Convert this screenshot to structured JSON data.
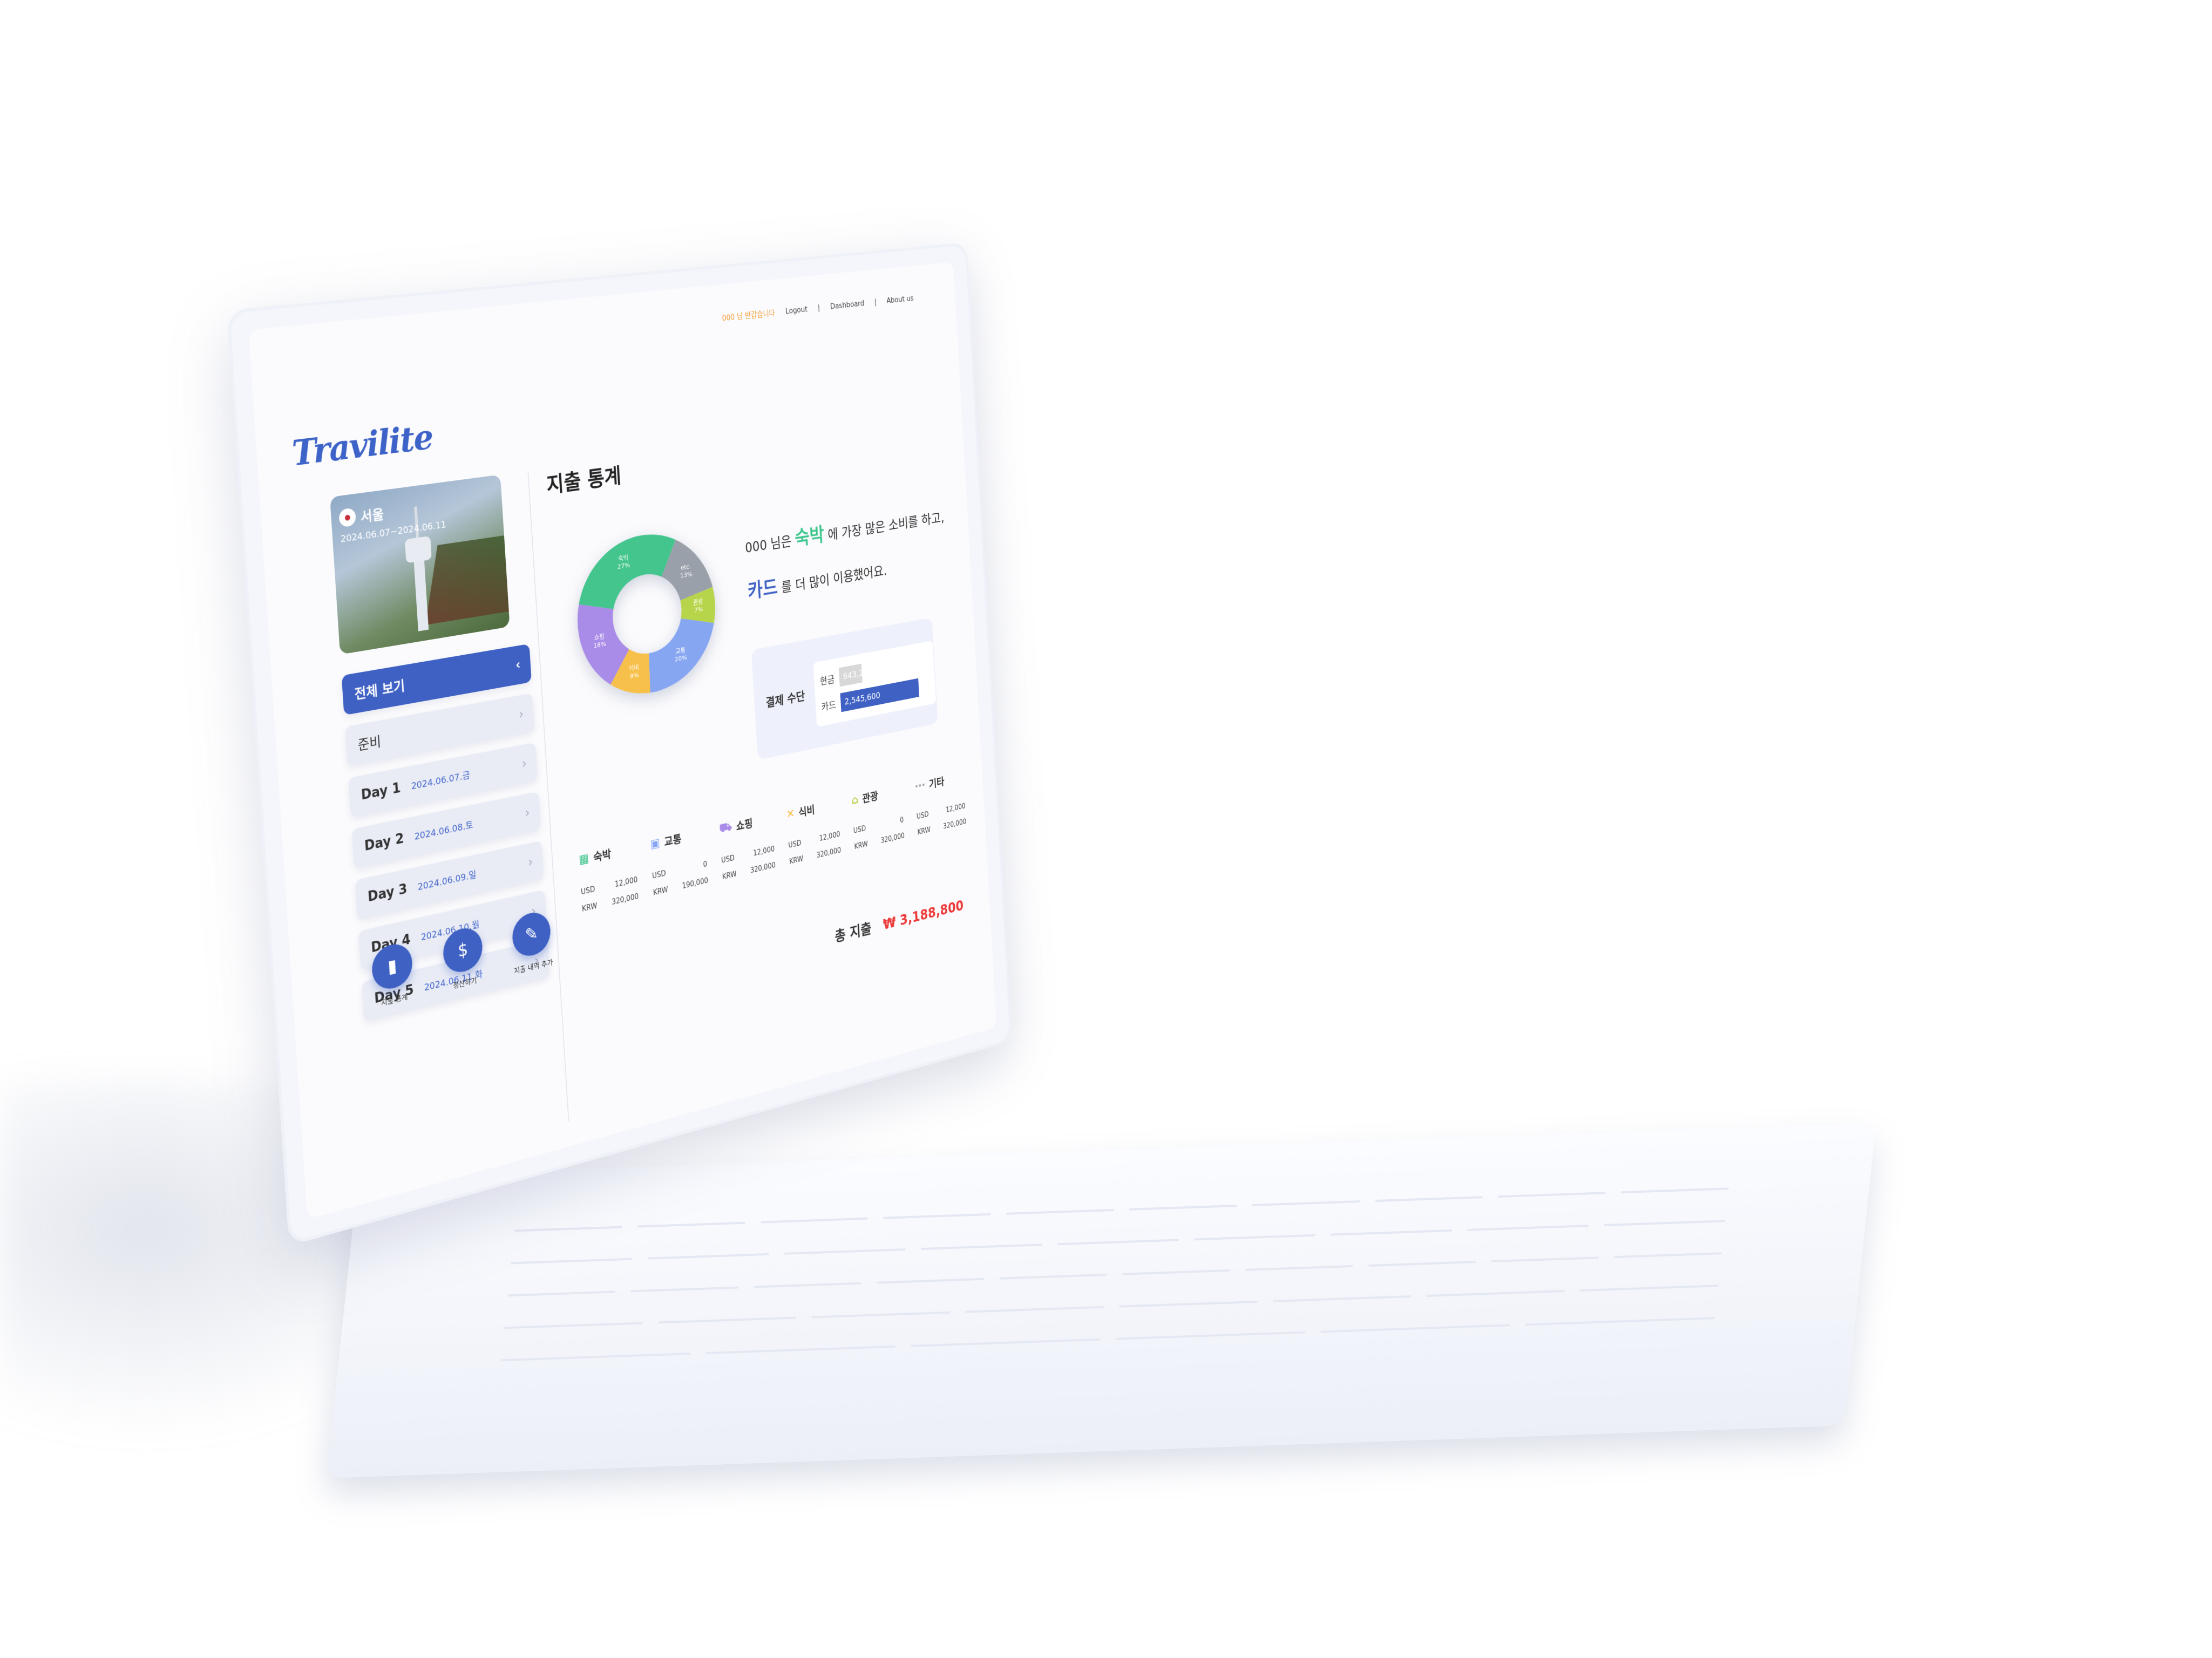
{
  "nav": {
    "user_greeting": "000 님 반갑습니다",
    "logout": "Logout",
    "sep": "|",
    "dashboard": "Dashboard",
    "about": "About us"
  },
  "logo": "Travilite",
  "trip": {
    "city": "서울",
    "dates": "2024.06.07~2024.06.11",
    "flag": "korea-flag-icon"
  },
  "menu": {
    "all": "전체 보기",
    "prep": "준비",
    "days": [
      {
        "label": "Day 1",
        "date": "2024.06.07.금"
      },
      {
        "label": "Day 2",
        "date": "2024.06.08.토"
      },
      {
        "label": "Day 3",
        "date": "2024.06.09.일"
      },
      {
        "label": "Day 4",
        "date": "2024.06.10.월"
      },
      {
        "label": "Day 5",
        "date": "2024.06.11.화"
      }
    ]
  },
  "fabs": [
    {
      "label": "지출 통계",
      "icon": "bar-chart-icon"
    },
    {
      "label": "정산하기",
      "icon": "receipt-icon"
    },
    {
      "label": "지출 내역 추가",
      "icon": "pencil-icon"
    }
  ],
  "main": {
    "title": "지출 통계",
    "summary_prefix": "000 님은",
    "summary_top_category": "숙박",
    "summary_mid": "에 가장 많은 소비를 하고,",
    "summary_top_method": "카드",
    "summary_end": "를 더 많이 이용했어요."
  },
  "chart_data": {
    "type": "pie",
    "categories": [
      "숙박",
      "etc.",
      "관광",
      "교통",
      "식비",
      "쇼핑"
    ],
    "values": [
      27,
      13,
      7,
      20,
      9,
      18
    ],
    "segment_labels": [
      "숙박\n27%",
      "etc.\n13%",
      "관광\n7%",
      "교통\n20%",
      "식비\n9%",
      "쇼핑\n18%"
    ],
    "colors": [
      "#44c58e",
      "#9aa0aa",
      "#b7d54a",
      "#86a6f2",
      "#f7c04a",
      "#a98be8"
    ],
    "donut": true
  },
  "payment": {
    "title": "결제 수단",
    "cash_label": "현금",
    "cash_value": "643,200",
    "card_label": "카드",
    "card_value": "2,545,600",
    "cash_share": 0.2,
    "card_share": 0.8
  },
  "categories": [
    {
      "name": "숙박",
      "icon": "building-icon",
      "color": "#44c58e",
      "usd_label": "USD",
      "usd": "12,000",
      "krw_label": "KRW",
      "krw": "320,000"
    },
    {
      "name": "교통",
      "icon": "bus-icon",
      "color": "#86a6f2",
      "usd_label": "USD",
      "usd": "0",
      "krw_label": "KRW",
      "krw": "190,000"
    },
    {
      "name": "쇼핑",
      "icon": "cart-icon",
      "color": "#a98be8",
      "usd_label": "USD",
      "usd": "12,000",
      "krw_label": "KRW",
      "krw": "320,000"
    },
    {
      "name": "식비",
      "icon": "utensils-icon",
      "color": "#f7c04a",
      "usd_label": "USD",
      "usd": "12,000",
      "krw_label": "KRW",
      "krw": "320,000"
    },
    {
      "name": "관광",
      "icon": "landmark-icon",
      "color": "#b7d54a",
      "usd_label": "USD",
      "usd": "0",
      "krw_label": "KRW",
      "krw": "320,000"
    },
    {
      "name": "기타",
      "icon": "dots-icon",
      "color": "#9aa0aa",
      "usd_label": "USD",
      "usd": "12,000",
      "krw_label": "KRW",
      "krw": "320,000"
    }
  ],
  "total": {
    "label": "총 지출",
    "amount": "₩ 3,188,800"
  }
}
